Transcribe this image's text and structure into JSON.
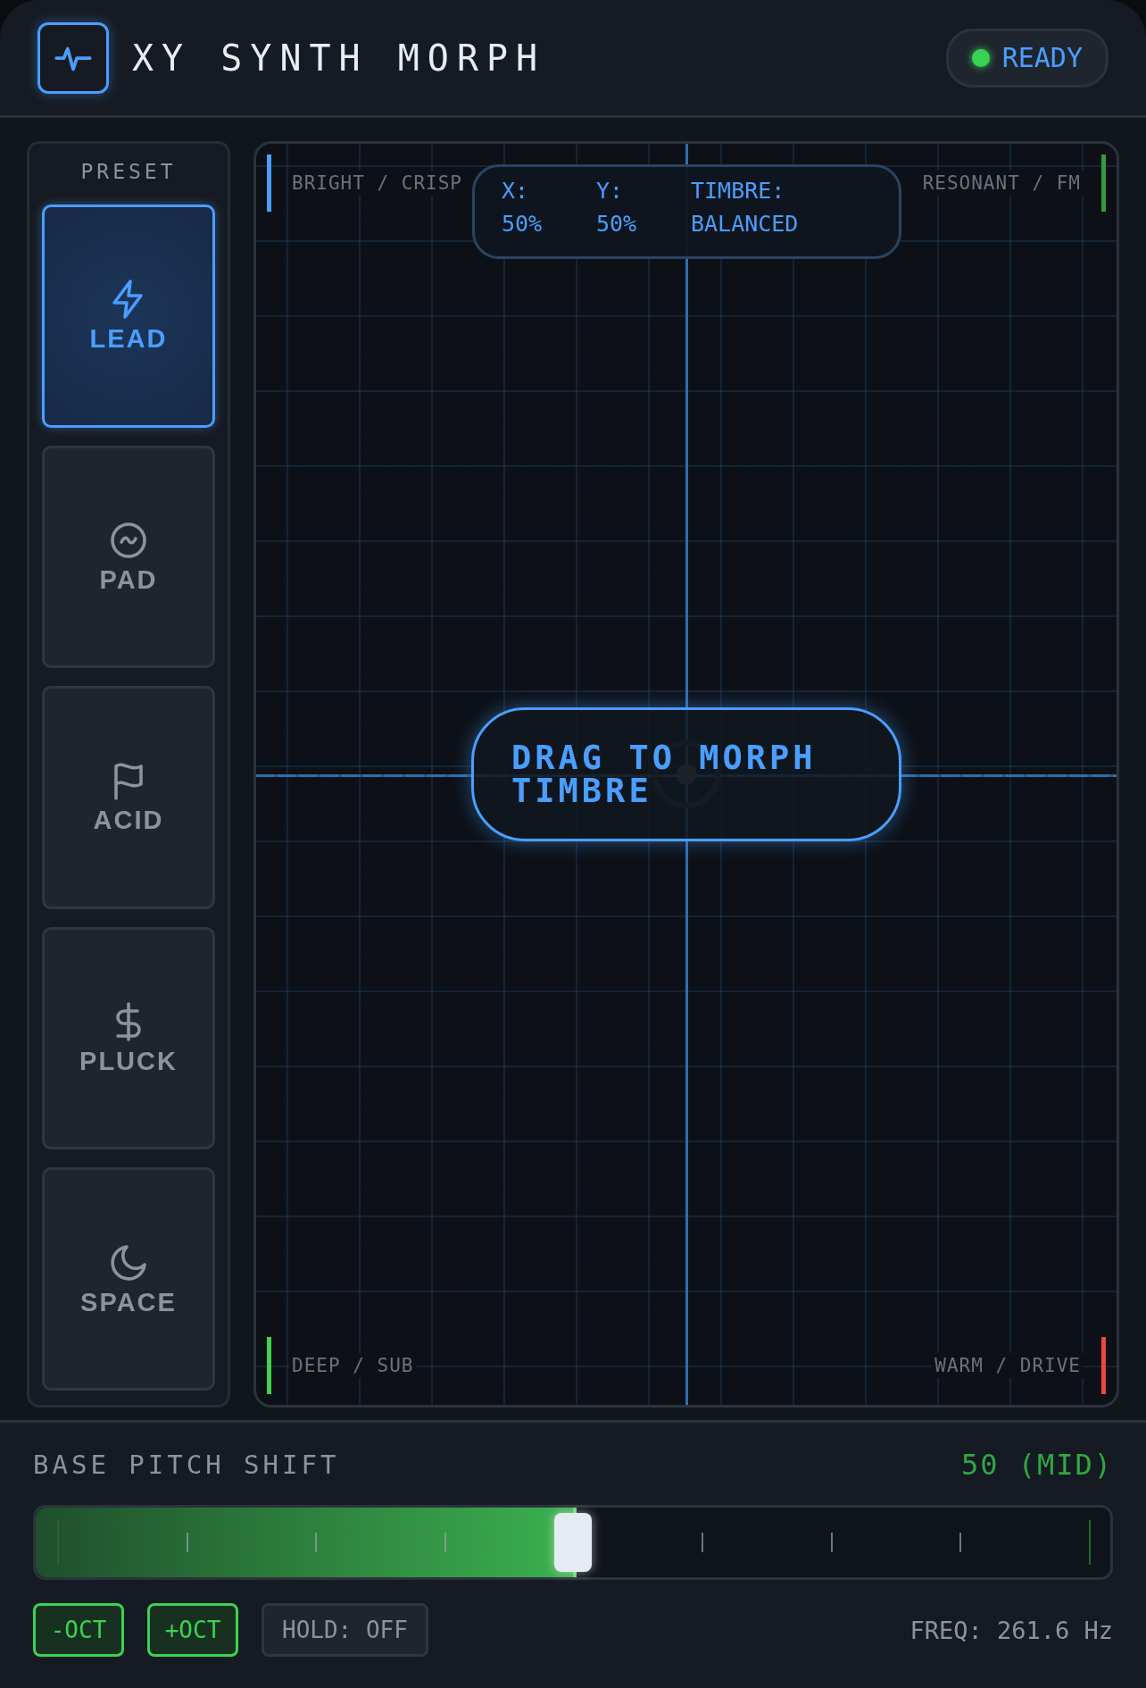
{
  "header": {
    "title": "XY SYNTH MORPH",
    "status": {
      "label": "READY",
      "on": true
    }
  },
  "sidebar": {
    "title": "PRESET",
    "presets": [
      {
        "label": "LEAD",
        "selected": true
      },
      {
        "label": "PAD",
        "selected": false
      },
      {
        "label": "ACID",
        "selected": false
      },
      {
        "label": "PLUCK",
        "selected": false
      },
      {
        "label": "SPACE",
        "selected": false
      }
    ]
  },
  "pad": {
    "corners": [
      {
        "label": "BRIGHT / CRISP",
        "color": "#4a9eff"
      },
      {
        "label": "RESONANT / FM",
        "color": "#2e9e3e"
      },
      {
        "label": "DEEP / SUB",
        "color": "#3fd14f"
      },
      {
        "label": "WARM / DRIVE",
        "color": "#f0463c"
      }
    ],
    "readout": [
      {
        "label": "X:",
        "value": "50%"
      },
      {
        "label": "Y:",
        "value": "50%"
      },
      {
        "label": "TIMBRE:",
        "value": "BALANCED"
      }
    ],
    "hint": "DRAG TO MORPH TIMBRE"
  },
  "pitch": {
    "label": "BASE PITCH SHIFT",
    "reading": "50 (MID)",
    "level": 0.5
  },
  "buttons": [
    {
      "label": "-OCT",
      "kind": "octave"
    },
    {
      "label": "+OCT",
      "kind": "octave"
    },
    {
      "label": "HOLD: OFF",
      "kind": "hold"
    }
  ],
  "freq": "FREQ: 261.6 Hz"
}
